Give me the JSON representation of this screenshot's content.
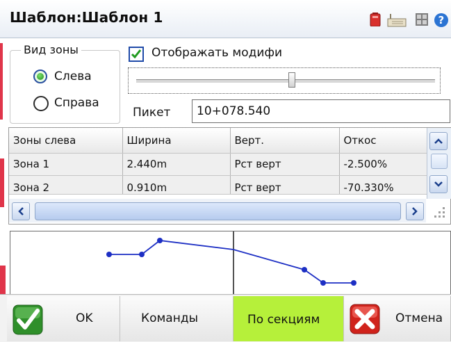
{
  "window": {
    "title": "Шаблон:Шаблон 1",
    "icons": [
      "battery-icon",
      "receiver-icon",
      "network-icon",
      "help-icon"
    ]
  },
  "zone_group": {
    "legend": "Вид зоны",
    "options": [
      {
        "label": "Слева",
        "checked": true
      },
      {
        "label": "Справа",
        "checked": false
      }
    ]
  },
  "show_modifier": {
    "label": "Отображать модифи",
    "checked": true
  },
  "slider": {
    "value_fraction": 0.52
  },
  "piket": {
    "label": "Пикет",
    "value": "10+078.540"
  },
  "table": {
    "headers": [
      "Зоны слева",
      "Ширина",
      "Верт.",
      "Откос"
    ],
    "rows": [
      [
        "Зона 1",
        "2.440m",
        "Рст верт",
        "-2.500%"
      ],
      [
        "Зона 2",
        "0.910m",
        "Рст верт",
        "-70.330%"
      ]
    ]
  },
  "buttons": {
    "ok": "OK",
    "commands": "Команды",
    "sections": "По секциям",
    "cancel": "Отмена"
  },
  "colors": {
    "accent_green": "#b6f03a",
    "profile_line": "#1d2fc4",
    "stripe_red": "#e0354a"
  }
}
